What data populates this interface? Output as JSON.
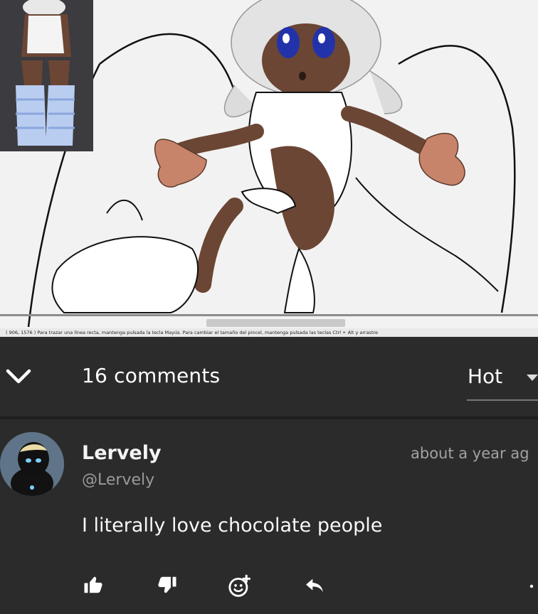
{
  "status_bar": {
    "text": "( 906, 1576 )   Para trazar una línea recta, mantenga pulsada la tecla Mayús. Para cambiar el tamaño del pincel, mantenga pulsada las teclas Ctrl + Alt y arrastre"
  },
  "comments": {
    "count_label": "16 comments",
    "sort_label": "Hot",
    "collapse_icon": "chevron-down-icon",
    "sort_icon": "caret-down-icon"
  },
  "comment": {
    "author": "Lervely",
    "handle": "@Lervely",
    "time": "about a year ag",
    "text": "I literally love chocolate people",
    "actions": [
      "thumbs-up-icon",
      "thumbs-down-icon",
      "add-reaction-icon",
      "reply-icon",
      "more-icon"
    ]
  },
  "colors": {
    "background": "#2b2b2b",
    "canvas": "#f2f2f2",
    "text": "#ffffff",
    "muted": "#9a9a9a"
  }
}
